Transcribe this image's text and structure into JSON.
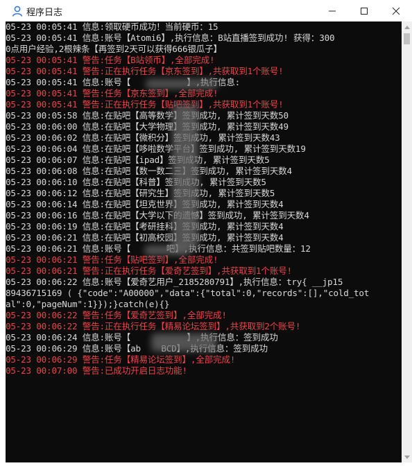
{
  "window": {
    "title": "程序日志",
    "icons": {
      "app": "user-icon",
      "minimize": "minimize-icon",
      "maximize": "maximize-icon",
      "close": "close-icon"
    }
  },
  "colors": {
    "info": "#d9d9d9",
    "warn": "#e8454a",
    "background": "#0c0c0c"
  },
  "log": [
    {
      "type": "info",
      "text": "05-23 00:05:41 信息:领取硬币成功！当前硬币：15"
    },
    {
      "type": "info",
      "text": "05-23 00:05:41 信息:账号【Atomi6】,执行信息：B站直播签到成功! 获得：300"
    },
    {
      "type": "info",
      "text": "0点用户经验,2根辣条【再签到2天可以获得666银瓜子】"
    },
    {
      "type": "warn",
      "text": "05-23 00:05:41 警告:任务【B站领币】,全部完成!"
    },
    {
      "type": "warn",
      "text": "05-23 00:05:41 警告:正在执行任务【京东签到】,共获取到1个账号!"
    },
    {
      "type": "info",
      "text": "05-23 00:05:41 信息:账号【           】,执行信息:"
    },
    {
      "type": "warn",
      "text": "05-23 00:05:41 警告:任务【京东签到】,全部完成!"
    },
    {
      "type": "warn",
      "text": "05-23 00:05:41 警告:正在执行任务【贴吧签到】,共获取到1个账号!"
    },
    {
      "type": "info",
      "text": "05-23 00:05:58 信息:在贴吧【高等数学】签到成功, 累计签到天数50"
    },
    {
      "type": "info",
      "text": "05-23 00:06:00 信息:在贴吧【大学物理】签到成功, 累计签到天数49"
    },
    {
      "type": "info",
      "text": "05-23 00:06:02 信息:在贴吧【微积分】签到成功, 累计签到天数43"
    },
    {
      "type": "info",
      "text": "05-23 00:06:04 信息:在贴吧【哆啦数学平台】签到成功, 累计签到天数19"
    },
    {
      "type": "info",
      "text": "05-23 00:06:07 信息:在贴吧【ipad】签到成功, 累计签到天数5"
    },
    {
      "type": "info",
      "text": "05-23 00:06:08 信息:在贴吧【数一数二三】签到成功, 累计签到天数4"
    },
    {
      "type": "info",
      "text": "05-23 00:06:10 信息:在贴吧【科普】签到成功, 累计签到天数5"
    },
    {
      "type": "info",
      "text": "05-23 00:06:12 信息:在贴吧【研究生】签到成功, 累计签到天数5"
    },
    {
      "type": "info",
      "text": "05-23 00:06:14 信息:在贴吧【坦克世界】签到成功, 累计签到天数4"
    },
    {
      "type": "info",
      "text": "05-23 00:06:16 信息:在贴吧【大学以下的遗憾】签到成功, 累计签到天数4"
    },
    {
      "type": "info",
      "text": "05-23 00:06:19 信息:在贴吧【考研挂科】签到成功, 累计签到天数4"
    },
    {
      "type": "info",
      "text": "05-23 00:06:21 信息:在贴吧【初高校园】签到成功, 累计签到天数4"
    },
    {
      "type": "info",
      "text": "05-23 00:06:21 信息:账号【       吧】,执行信息：共签到贴吧数量：12"
    },
    {
      "type": "warn",
      "text": "05-23 00:06:21 警告:任务【贴吧签到】,全部完成!"
    },
    {
      "type": "warn",
      "text": "05-23 00:06:21 警告:正在执行任务【爱奇艺签到】,共获取到1个账号!"
    },
    {
      "type": "info",
      "text": "05-23 00:06:22 信息:账号【爱奇艺用户_2185280791】,执行信息：try{ __jp15"
    },
    {
      "type": "info",
      "text": "89436715169 ( {\"code\":\"A00000\",\"data\":{\"total\":0,\"records\":[],\"cold_tot"
    },
    {
      "type": "info",
      "text": "al\":0,\"pageNum\":1}});}catch(e){}"
    },
    {
      "type": "warn",
      "text": "05-23 00:06:22 警告:任务【爱奇艺签到】,全部完成!"
    },
    {
      "type": "warn",
      "text": "05-23 00:06:22 警告:正在执行任务【精易论坛签到】,共获取到2个账号!"
    },
    {
      "type": "info",
      "text": "05-23 00:06:24 信息:账号【           】,执行信息：签到成功"
    },
    {
      "type": "info",
      "text": "05-23 00:06:29 信息:账号【ab    BCD】,执行信息：签到成功"
    },
    {
      "type": "warn",
      "text": "05-23 00:06:29 警告:任务【精易论坛签到】,全部完成!"
    },
    {
      "type": "warn",
      "text": "05-23 00:07:00 警告:已成功开启日志功能!"
    }
  ]
}
